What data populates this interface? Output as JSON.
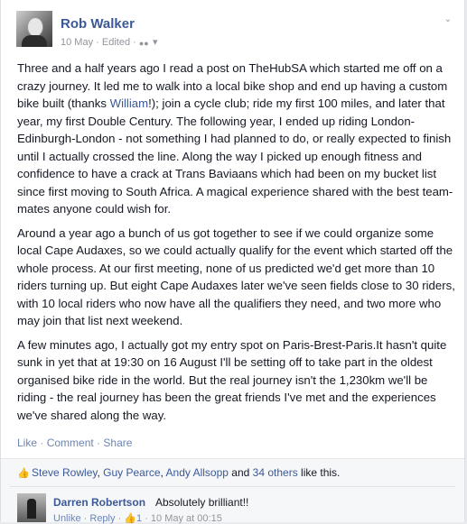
{
  "post": {
    "author": "Rob Walker",
    "date": "10 May",
    "edited": "Edited",
    "paragraphs": [
      {
        "before": "Three and a half years ago I read a post on TheHubSA which started me off on a crazy journey. It led me to walk into a local bike shop and end up having a custom bike built (thanks ",
        "link": "William",
        "after": "!); join a cycle club; ride my first 100 miles, and later that year, my first Double Century. The following year, I ended up riding London-Edinburgh-London - not something I had planned to do, or really expected to finish until I actually crossed the line. Along the way I picked up enough fitness and confidence to have a crack at Trans Baviaans which had been on my bucket list since first moving to South Africa. A magical experience shared with the best team-mates anyone could wish for."
      },
      {
        "text": "Around a year ago a bunch of us got together to see if we could organize some local Cape Audaxes, so we could actually qualify for the event which started off the whole process. At our first meeting, none of us predicted we'd get more than 10 riders turning up. But eight Cape Audaxes later we've seen fields close to 30 riders, with 10 local riders who now have all the qualifiers they need, and two more who may join that list next weekend."
      },
      {
        "text": "A few minutes ago, I actually got my entry spot on Paris-Brest-Paris.It hasn't quite sunk in yet that at 19:30 on 16 August I'll be setting off to take part in the oldest organised bike ride in the world. But the real journey isn't the 1,230km we'll be riding - the real journey has been the great friends I've met and the experiences we've shared along the way."
      }
    ],
    "actions": [
      "Like",
      "Comment",
      "Share"
    ]
  },
  "likes": {
    "names": [
      "Steve Rowley",
      "Guy Pearce",
      "Andy Allsopp"
    ],
    "and": "and",
    "others": "34 others",
    "suffix": "like this."
  },
  "comment": {
    "author": "Darren Robertson",
    "text": "Absolutely brilliant!!",
    "unlike": "Unlike",
    "reply": "Reply",
    "like_count": "1",
    "time": "10 May at 00:15"
  }
}
